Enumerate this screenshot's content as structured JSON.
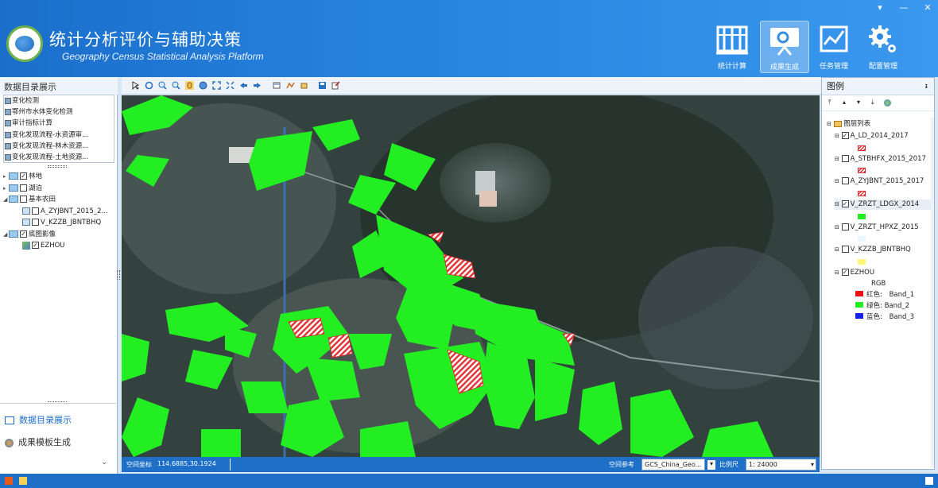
{
  "app": {
    "title": "统计分析评价与辅助决策",
    "subtitle": "Geography Census Statistical Analysis Platform"
  },
  "window_controls": [
    "▾",
    "—",
    "✕"
  ],
  "toolbar_buttons": [
    {
      "label": "统计计算",
      "icon": "abacus-icon",
      "active": false
    },
    {
      "label": "成果生成",
      "icon": "presentation-board-icon",
      "active": true
    },
    {
      "label": "任务管理",
      "icon": "checklist-chart-icon",
      "active": false
    },
    {
      "label": "配置管理",
      "icon": "gears-icon",
      "active": false
    }
  ],
  "left_panel": {
    "title": "数据目录展示",
    "catalog": [
      "变化检测",
      "鄂州市水体变化检测",
      "审计指标计算",
      "变化发现流程-水资源审...",
      "变化发现流程-林木资源...",
      "变化发现流程-土地资源..."
    ],
    "tree": {
      "nodes": [
        {
          "label": "林地",
          "checked": true,
          "level": 0
        },
        {
          "label": "湖泊",
          "checked": false,
          "level": 0
        },
        {
          "label": "基本农田",
          "checked": false,
          "level": 0
        },
        {
          "label": "A_ZYJBNT_2015_2...",
          "checked": false,
          "level": 1
        },
        {
          "label": "V_KZZB_JBNTBHQ",
          "checked": false,
          "level": 1
        },
        {
          "label": "底图影像",
          "checked": true,
          "level": 0
        },
        {
          "label": "EZHOU",
          "checked": true,
          "level": 1
        }
      ]
    },
    "nav": [
      "数据目录展示",
      "成果模板生成"
    ]
  },
  "status": {
    "coord_label": "空间坐标",
    "coord_value": "114.6885,30.1924",
    "ref_label": "空间参考",
    "ref_value": "GCS_China_Geo...",
    "scale_label": "比例尺",
    "scale_value": "1: 24000"
  },
  "legend": {
    "title": "图例",
    "pin": "ᵻ",
    "root": "图层列表",
    "layers": [
      {
        "name": "A_LD_2014_2017",
        "checked": true,
        "swatch": "hatch-red"
      },
      {
        "name": "A_STBHFX_2015_2017",
        "checked": false,
        "swatch": "hatch-red"
      },
      {
        "name": "A_ZYJBNT_2015_2017",
        "checked": false,
        "swatch": "hatch-red"
      },
      {
        "name": "V_ZRZT_LDGX_2014",
        "checked": true,
        "swatch": "#22ee22"
      },
      {
        "name": "V_ZRZT_HPXZ_2015",
        "checked": false,
        "swatch": "#e8f6ff"
      },
      {
        "name": "V_KZZB_JBNTBHQ",
        "checked": false,
        "swatch": "#fff67a"
      },
      {
        "name": "EZHOU",
        "checked": true,
        "swatch": "none"
      }
    ],
    "rgb_label": "RGB",
    "bands": [
      {
        "channel": "红色:",
        "band": "Band_1",
        "color": "#ee1111"
      },
      {
        "channel": "绿色:",
        "band": "Band_2",
        "color": "#22ee22"
      },
      {
        "channel": "蓝色:",
        "band": "Band_3",
        "color": "#1122ee"
      }
    ]
  },
  "colors": {
    "title_bar": "#1b6fcb",
    "forest": "#22ee22",
    "change_hatch": "#e0383a",
    "status_bar": "#1d6fc8"
  }
}
